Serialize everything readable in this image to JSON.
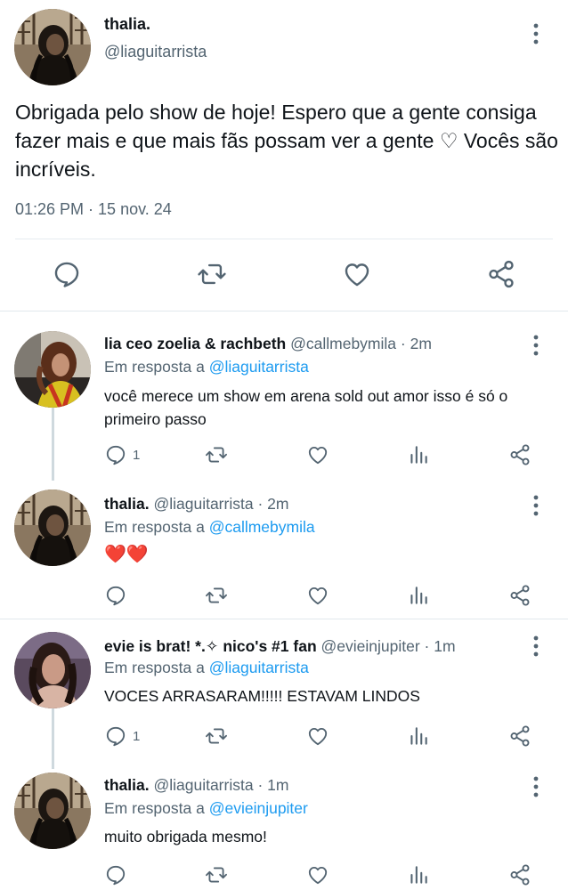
{
  "main": {
    "name": "thalia.",
    "handle": "@liaguitarrista",
    "text": "Obrigada pelo show de hoje! Espero que a gente consiga fazer mais e que mais fãs possam ver a gente ♡ Vocês são incríveis.",
    "timestamp": "01:26 PM · 15 nov. 24",
    "actions": [
      "reply-icon",
      "retweet-icon",
      "like-icon",
      "share-icon"
    ]
  },
  "replies": [
    {
      "name": "lia ceo zoelia & rachbeth",
      "handle": "@callmebymila",
      "time": "· 2m",
      "reply_label": "Em resposta a",
      "reply_to": "@liaguitarrista",
      "text": "você merece um show em arena sold out amor isso é só o primeiro passo",
      "reply_count": "1"
    },
    {
      "name": "thalia.",
      "handle": "@liaguitarrista",
      "time": "· 2m",
      "reply_label": "Em resposta a",
      "reply_to": "@callmebymila",
      "text": "❤️❤️",
      "reply_count": ""
    },
    {
      "name": "evie is brat! *.✧ nico's #1 fan",
      "handle": "@evieinjupiter",
      "time": "· 1m",
      "reply_label": "Em resposta a",
      "reply_to": "@liaguitarrista",
      "text": "VOCES ARRASARAM!!!!! ESTAVAM LINDOS",
      "reply_count": "1"
    },
    {
      "name": "thalia.",
      "handle": "@liaguitarrista",
      "time": "· 1m",
      "reply_label": "Em resposta a",
      "reply_to": "@evieinjupiter",
      "text": "muito obrigada mesmo!",
      "reply_count": ""
    }
  ],
  "colors": {
    "text": "#0f1419",
    "secondary": "#536471",
    "link": "#1d9bf0",
    "icon": "#536471",
    "divider": "#e1e8ed"
  }
}
